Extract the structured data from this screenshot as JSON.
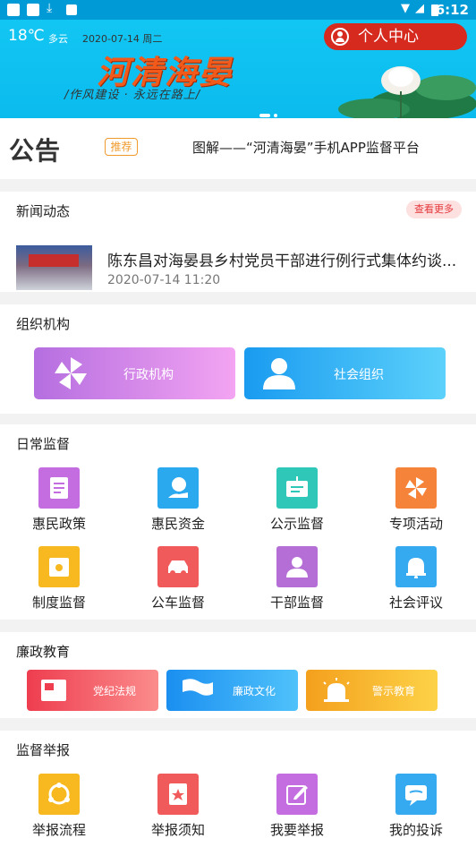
{
  "status": {
    "time": "6:12"
  },
  "banner": {
    "temperature": "18℃",
    "weather": "多云",
    "date": "2020-07-14 周二",
    "brand": "河清海晏",
    "slogan": "/作风建设 · 永远在路上/",
    "personal_center": "个人中心"
  },
  "notice": {
    "label": "公告",
    "tag": "推荐",
    "text": "图解——“河清海晏”手机APP监督平台"
  },
  "news": {
    "title": "新闻动态",
    "more": "查看更多",
    "item": {
      "headline": "陈东昌对海晏县乡村党员干部进行例行式集体约谈...",
      "time": "2020-07-14 11:20"
    }
  },
  "org": {
    "title": "组织机构",
    "items": [
      {
        "label": "行政机构",
        "icon": "pinwheel-icon",
        "colors": [
          "#b56ee0",
          "#f3a4f2"
        ]
      },
      {
        "label": "社会组织",
        "icon": "person-icon",
        "colors": [
          "#1a9bf0",
          "#5cd1fb"
        ]
      }
    ]
  },
  "daily": {
    "title": "日常监督",
    "items": [
      {
        "label": "惠民政策",
        "icon": "document-icon",
        "color": "#c46de0"
      },
      {
        "label": "惠民资金",
        "icon": "yuan-hand-icon",
        "color": "#2aa9ef"
      },
      {
        "label": "公示监督",
        "icon": "notice-board-icon",
        "color": "#2fc7b8"
      },
      {
        "label": "专项活动",
        "icon": "pinwheel-icon",
        "color": "#f5833a"
      },
      {
        "label": "制度监督",
        "icon": "folder-icon",
        "color": "#f7b91f"
      },
      {
        "label": "公车监督",
        "icon": "car-icon",
        "color": "#f05a5a"
      },
      {
        "label": "干部监督",
        "icon": "person-icon",
        "color": "#b46ed6"
      },
      {
        "label": "社会评议",
        "icon": "bell-icon",
        "color": "#35aaf1"
      }
    ]
  },
  "edu": {
    "title": "廉政教育",
    "items": [
      {
        "label": "党纪法规",
        "icon": "party-book-icon",
        "colors": [
          "#ee3d4f",
          "#fb8c8c"
        ]
      },
      {
        "label": "廉政文化",
        "icon": "flag-icon",
        "colors": [
          "#1b8ff0",
          "#4fc2fb"
        ]
      },
      {
        "label": "警示教育",
        "icon": "alarm-light-icon",
        "colors": [
          "#f4a01d",
          "#fdd247"
        ]
      }
    ]
  },
  "report": {
    "title": "监督举报",
    "items": [
      {
        "label": "举报流程",
        "icon": "flow-icon",
        "color": "#f7b91f"
      },
      {
        "label": "举报须知",
        "icon": "star-doc-icon",
        "color": "#f05a5a"
      },
      {
        "label": "我要举报",
        "icon": "pen-icon",
        "color": "#c46de0"
      },
      {
        "label": "我的投诉",
        "icon": "chat-icon",
        "color": "#35aaf1"
      }
    ]
  }
}
